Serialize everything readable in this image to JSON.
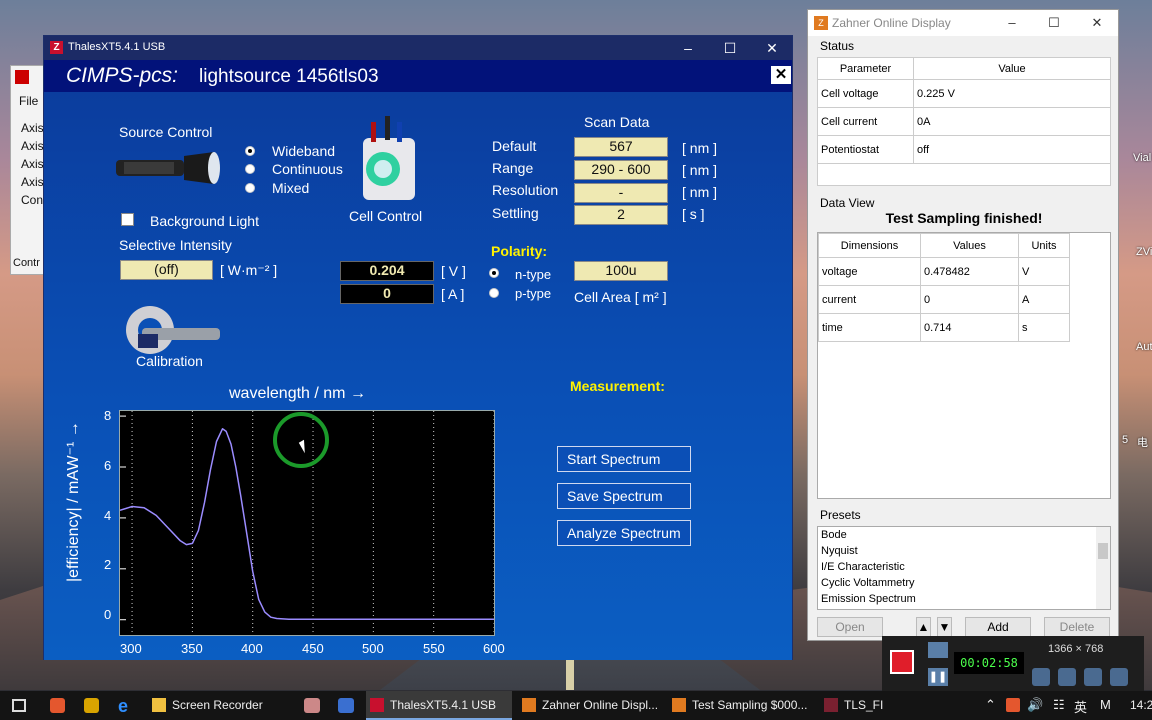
{
  "thales": {
    "window_title": "ThalesXT5.4.1 USB",
    "app_name": "CIMPS-pcs:",
    "file_name": "lightsource 1456tls03",
    "source_control": {
      "label": "Source Control",
      "options": [
        "Wideband",
        "Continuous",
        "Mixed"
      ]
    },
    "background_light_label": "Background Light",
    "selective_intensity": {
      "label": "Selective Intensity",
      "value": "(off)",
      "unit": "[ W·m⁻² ]"
    },
    "cell_control_label": "Cell Control",
    "voltage": {
      "value": "0.204",
      "unit": "[ V ]"
    },
    "current": {
      "value": "0",
      "unit": "[ A ]"
    },
    "calibration_label": "Calibration",
    "scan_data": {
      "label": "Scan Data",
      "rows": [
        {
          "name": "Default",
          "value": "567",
          "unit": "[ nm ]"
        },
        {
          "name": "Range",
          "value": "290 - 600",
          "unit": "[ nm ]"
        },
        {
          "name": "Resolution",
          "value": "-",
          "unit": "[ nm ]"
        },
        {
          "name": "Settling",
          "value": "2",
          "unit": "[ s ]"
        }
      ]
    },
    "polarity": {
      "label": "Polarity:",
      "options": [
        "n-type",
        "p-type"
      ]
    },
    "cell_area": {
      "value": "100u",
      "label": "Cell Area [ m² ]"
    },
    "measurement": {
      "label": "Measurement:",
      "buttons": [
        "Start Spectrum",
        "Save Spectrum",
        "Analyze Spectrum"
      ]
    }
  },
  "chart_data": {
    "type": "line",
    "title": "",
    "xlabel": "wavelength / nm →",
    "ylabel": "|efficiency| / mAW⁻¹ →",
    "xlim": [
      290,
      600
    ],
    "ylim": [
      -0.6,
      8.2
    ],
    "xticks": [
      "300",
      "350",
      "400",
      "450",
      "500",
      "550",
      "600"
    ],
    "yticks": [
      "0",
      "2",
      "4",
      "6",
      "8"
    ],
    "grid": "vertical dotted",
    "series": [
      {
        "color": "#9b8cff",
        "x": [
          290,
          300,
          310,
          320,
          330,
          340,
          345,
          350,
          355,
          360,
          365,
          370,
          375,
          378,
          382,
          386,
          390,
          395,
          400,
          405,
          410,
          415,
          420,
          430,
          440,
          450,
          500,
          550,
          600
        ],
        "y": [
          4.3,
          4.45,
          4.4,
          4.1,
          3.6,
          3.1,
          2.95,
          3.0,
          3.5,
          4.6,
          5.9,
          7.0,
          7.5,
          7.4,
          6.9,
          6.0,
          4.9,
          3.4,
          1.9,
          0.8,
          0.3,
          0.1,
          0.05,
          0.02,
          0.02,
          0.02,
          0.02,
          0.02,
          0.02
        ]
      }
    ]
  },
  "zahner": {
    "window_title": "Zahner Online Display",
    "status_label": "Status",
    "status_headers": [
      "Parameter",
      "Value"
    ],
    "status_rows": [
      [
        "Cell voltage",
        "0.225 V"
      ],
      [
        "Cell current",
        "0A"
      ],
      [
        "Potentiostat",
        "off"
      ]
    ],
    "dataview_label": "Data View",
    "dataview_message": "Test Sampling finished!",
    "dataview_headers": [
      "Dimensions",
      "Values",
      "Units"
    ],
    "dataview_rows": [
      [
        "voltage",
        "0.478482",
        "V"
      ],
      [
        "current",
        "0",
        "A"
      ],
      [
        "time",
        "0.714",
        "s"
      ]
    ],
    "presets_label": "Presets",
    "presets": [
      "Bode",
      "Nyquist",
      "I/E Characteristic",
      "Cyclic Voltammetry",
      "Emission Spectrum"
    ],
    "buttons": {
      "open": "Open",
      "add": "Add",
      "delete": "Delete"
    }
  },
  "recorder": {
    "resolution": "1366 × 768",
    "time": "00:02:58"
  },
  "background_window": {
    "menu": "File",
    "items": [
      "Axis",
      "Axis",
      "Axis",
      "Axis",
      "Con"
    ],
    "bottom": "Contr"
  },
  "taskbar": {
    "items": [
      {
        "label": "Screen Recorder",
        "active": false
      },
      {
        "label": "ThalesXT5.4.1 USB",
        "active": true
      },
      {
        "label": "Zahner Online Displ...",
        "active": false
      },
      {
        "label": "Test Sampling $000...",
        "active": false
      },
      {
        "label": "TLS_FI",
        "active": false
      }
    ],
    "tray_lang": "英",
    "tray_ime": "M",
    "clock": "14:2"
  },
  "desktop_icons": [
    "Vial",
    "ZVi",
    "Aut",
    "5",
    "电"
  ]
}
